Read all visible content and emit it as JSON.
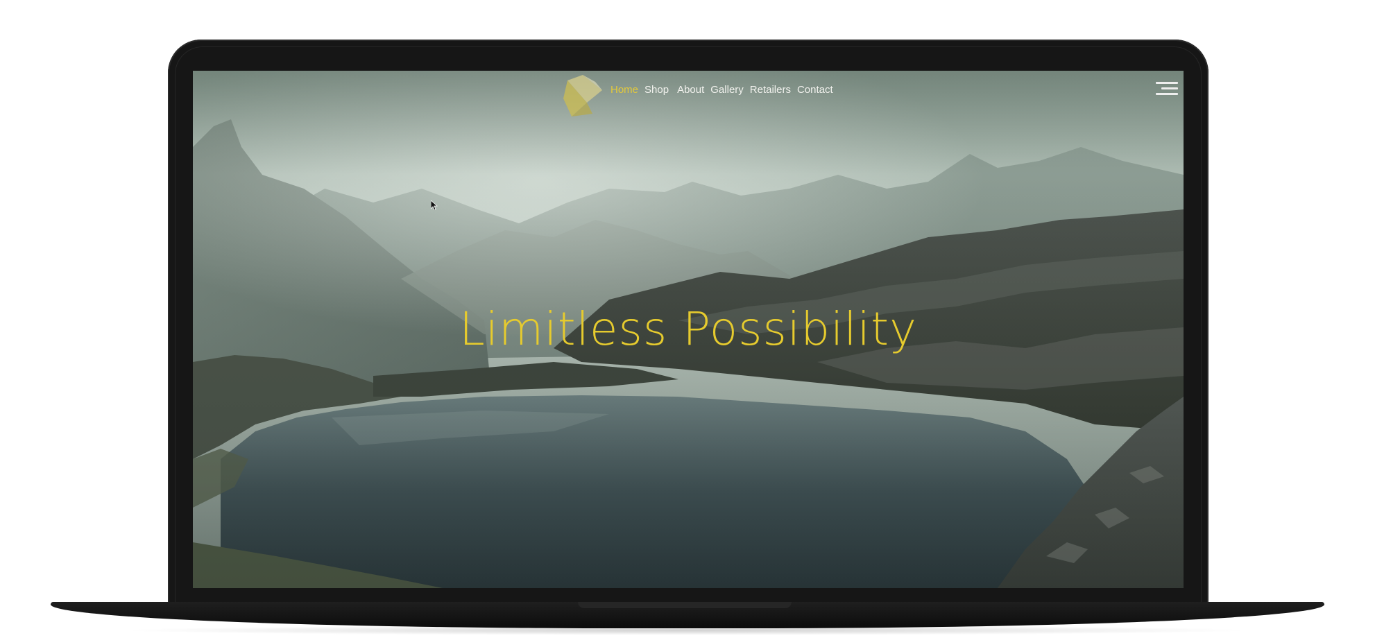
{
  "nav": {
    "items": [
      {
        "label": "Home",
        "active": true
      },
      {
        "label": "Shop",
        "active": false
      },
      {
        "label": "About",
        "active": false
      },
      {
        "label": "Gallery",
        "active": false
      },
      {
        "label": "Retailers",
        "active": false
      },
      {
        "label": "Contact",
        "active": false
      }
    ]
  },
  "hero": {
    "title": "Limitless Possibility"
  },
  "icons": {
    "logo": "gold-crystal-logo-icon",
    "menu": "hamburger-menu-icon",
    "cursor": "mouse-cursor-icon"
  },
  "colors": {
    "accent": "#e6cb2e",
    "nav_text": "#f2f2ee",
    "device_frame": "#161616"
  }
}
